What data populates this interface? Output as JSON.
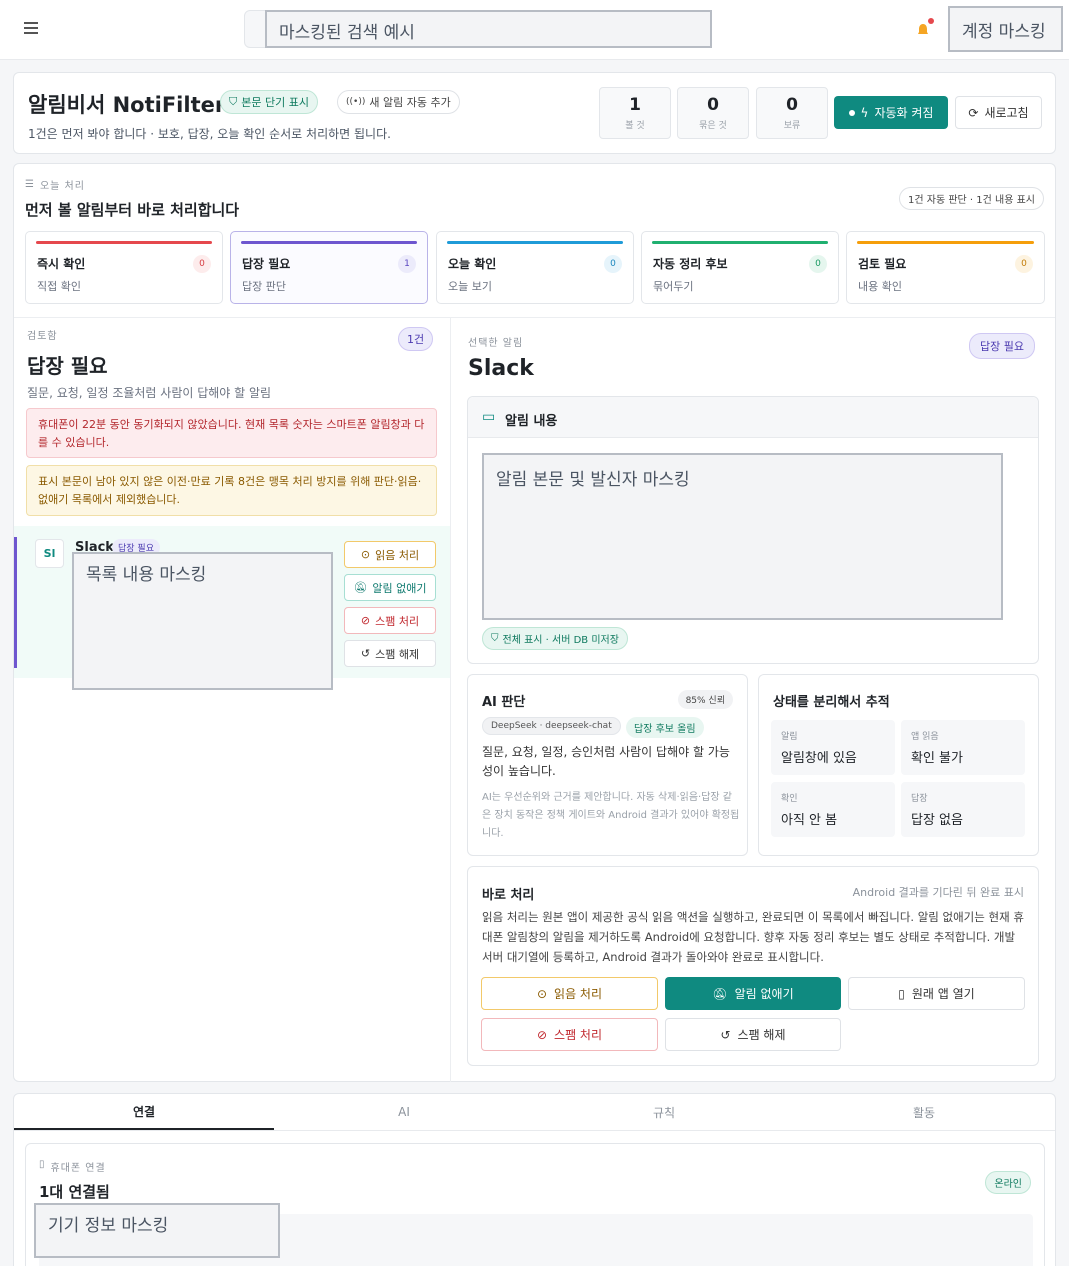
{
  "topbar": {
    "search_mask": "마스킹된 검색 예시",
    "account_mask": "계정 마스킹"
  },
  "header": {
    "title": "알림비서 NotiFilter",
    "badge_short": "본문 단기 표시",
    "badge_auto": "새 알림 자동 추가",
    "subtitle": "1건은 먼저 봐야 합니다 · 보호, 답장, 오늘 확인 순서로 처리하면 됩니다.",
    "stats": [
      {
        "value": "1",
        "label": "볼 것"
      },
      {
        "value": "0",
        "label": "묶은 것"
      },
      {
        "value": "0",
        "label": "보류"
      }
    ],
    "automation_button": "자동화 켜짐",
    "refresh_button": "새로고침"
  },
  "today": {
    "eyebrow": "오늘 처리",
    "title": "먼저 볼 알림부터 바로 처리합니다",
    "summary": "1건 자동 판단 · 1건 내용 표시",
    "categories": [
      {
        "title": "즉시 확인",
        "sub": "직접 확인",
        "count": "0",
        "color": "#e5484d"
      },
      {
        "title": "답장 필요",
        "sub": "답장 판단",
        "count": "1",
        "color": "#6e56cf"
      },
      {
        "title": "오늘 확인",
        "sub": "오늘 보기",
        "count": "0",
        "color": "#1f9bd8"
      },
      {
        "title": "자동 정리 후보",
        "sub": "묶어두기",
        "count": "0",
        "color": "#20b070"
      },
      {
        "title": "검토 필요",
        "sub": "내용 확인",
        "count": "0",
        "color": "#f59e0b"
      }
    ]
  },
  "list": {
    "eyebrow": "검토함",
    "count": "1건",
    "title": "답장 필요",
    "desc": "질문, 요청, 일정 조율처럼 사람이 답해야 할 알림",
    "warn_red": "휴대폰이 22분 동안 동기화되지 않았습니다. 현재 목록 숫자는 스마트폰 알림창과 다를 수 있습니다.",
    "warn_yellow": "표시 본문이 남아 있지 않은 이전·만료 기록 8건은 맹목 처리 방지를 위해 판단·읽음·없애기 목록에서 제외했습니다.",
    "item": {
      "avatar": "Sl",
      "app": "Slack",
      "tag": "답장 필요",
      "content_mask": "목록 내용 마스킹",
      "actions": [
        "읽음 처리",
        "알림 없애기",
        "스팸 처리",
        "스팸 해제"
      ]
    }
  },
  "detail": {
    "eyebrow": "선택한 알림",
    "title": "Slack",
    "tag": "답장 필요",
    "content_header": "알림 내용",
    "body_mask": "알림 본문 및 발신자 마스킹",
    "display_badge": "전체 표시 · 서버 DB 미저장",
    "ai": {
      "title": "AI 판단",
      "confidence": "85% 신뢰",
      "model": "DeepSeek · deepseek-chat",
      "reply_badge": "답장 후보 올림",
      "text": "질문, 요청, 일정, 승인처럼 사람이 답해야 할 가능성이 높습니다.",
      "note": "AI는 우선순위와 근거를 제안합니다. 자동 삭제·읽음·답장 같은 장치 동작은 정책 게이트와 Android 결과가 있어야 확정됩니다."
    },
    "status": {
      "title": "상태를 분리해서 추적",
      "items": [
        {
          "k": "알림",
          "v": "알림창에 있음"
        },
        {
          "k": "앱 읽음",
          "v": "확인 불가"
        },
        {
          "k": "확인",
          "v": "아직 안 봄"
        },
        {
          "k": "답장",
          "v": "답장 없음"
        }
      ]
    },
    "quick": {
      "title": "바로 처리",
      "hint": "Android 결과를 기다린 뒤 완료 표시",
      "desc": "읽음 처리는 원본 앱이 제공한 공식 읽음 액션을 실행하고, 완료되면 이 목록에서 빠집니다. 알림 없애기는 현재 휴대폰 알림창의 알림을 제거하도록 Android에 요청합니다. 향후 자동 정리 후보는 별도 상태로 추적합니다. 개발 서버 대기열에 등록하고, Android 결과가 돌아와야 완료로 표시합니다.",
      "read": "읽음 처리",
      "dismiss": "알림 없애기",
      "open": "원래 앱 열기",
      "spam": "스팸 처리",
      "unspam": "스팸 해제"
    }
  },
  "tabs": [
    "연결",
    "AI",
    "규칙",
    "활동"
  ],
  "connection": {
    "eyebrow": "휴대폰 연결",
    "title": "1대 연결됨",
    "online": "온라인",
    "device_mask": "기기 정보 마스킹"
  },
  "colors": {
    "teal": "#0f8a80",
    "accent_purple": "#6e56cf"
  }
}
